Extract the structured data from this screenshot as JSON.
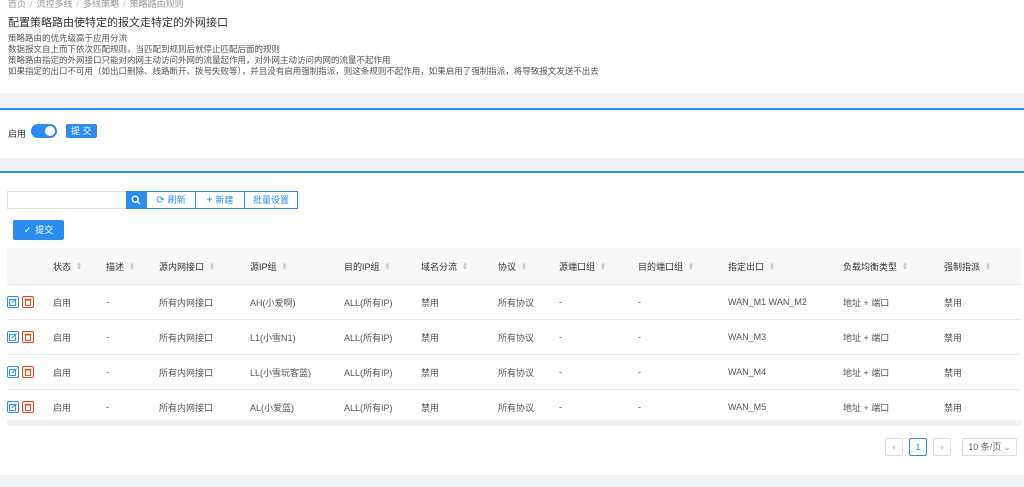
{
  "breadcrumb": [
    "首页",
    "流控多线",
    "多线策略",
    "策略路由规则"
  ],
  "page_title": "配置策略路由使特定的报文走特定的外网接口",
  "description": [
    "策略路由的优先级高于应用分流",
    "数据报文自上而下依次匹配规则，当匹配到规则后就停止匹配后面的规则",
    "策略路由指定的外网接口只能对内网主动访问外网的流量起作用，对外网主动访问内网的流量不起作用",
    "如果指定的出口不可用（如出口删除、线路断开、拨号失败等），并且没有启用强制指派，则这条规则不起作用，如果启用了强制指派，将导致报文发送不出去"
  ],
  "enable": {
    "label": "启用",
    "on": true,
    "submit_label": "提 交"
  },
  "toolbar": {
    "search_placeholder": "",
    "refresh_label": "刷新",
    "new_label": "新建",
    "batch_label": "批量设置",
    "submit_label": "提交"
  },
  "table": {
    "headers": [
      "状态",
      "描述",
      "源内网接口",
      "源IP组",
      "目的IP组",
      "域名分流",
      "协议",
      "源端口组",
      "目的端口组",
      "指定出口",
      "负载均衡类型",
      "强制指派"
    ],
    "rows": [
      [
        "启用",
        "-",
        "所有内网接口",
        "AH(小爱啊)",
        "ALL(所有IP)",
        "禁用",
        "所有协议",
        "-",
        "-",
        "WAN_M1 WAN_M2",
        "地址 + 端口",
        "禁用"
      ],
      [
        "启用",
        "-",
        "所有内网接口",
        "L1(小雪N1)",
        "ALL(所有IP)",
        "禁用",
        "所有协议",
        "-",
        "-",
        "WAN_M3",
        "地址 + 端口",
        "禁用"
      ],
      [
        "启用",
        "-",
        "所有内网接口",
        "LL(小雪玩客蓝)",
        "ALL(所有IP)",
        "禁用",
        "所有协议",
        "-",
        "-",
        "WAN_M4",
        "地址 + 端口",
        "禁用"
      ],
      [
        "启用",
        "-",
        "所有内网接口",
        "AL(小爱蓝)",
        "ALL(所有IP)",
        "禁用",
        "所有协议",
        "-",
        "-",
        "WAN_M5",
        "地址 + 端口",
        "禁用"
      ]
    ]
  },
  "pagination": {
    "prev": "‹",
    "current": "1",
    "next": "›",
    "page_size": "10 条/页"
  },
  "colors": {
    "primary": "#2d8cf0",
    "danger": "#ed4014"
  }
}
